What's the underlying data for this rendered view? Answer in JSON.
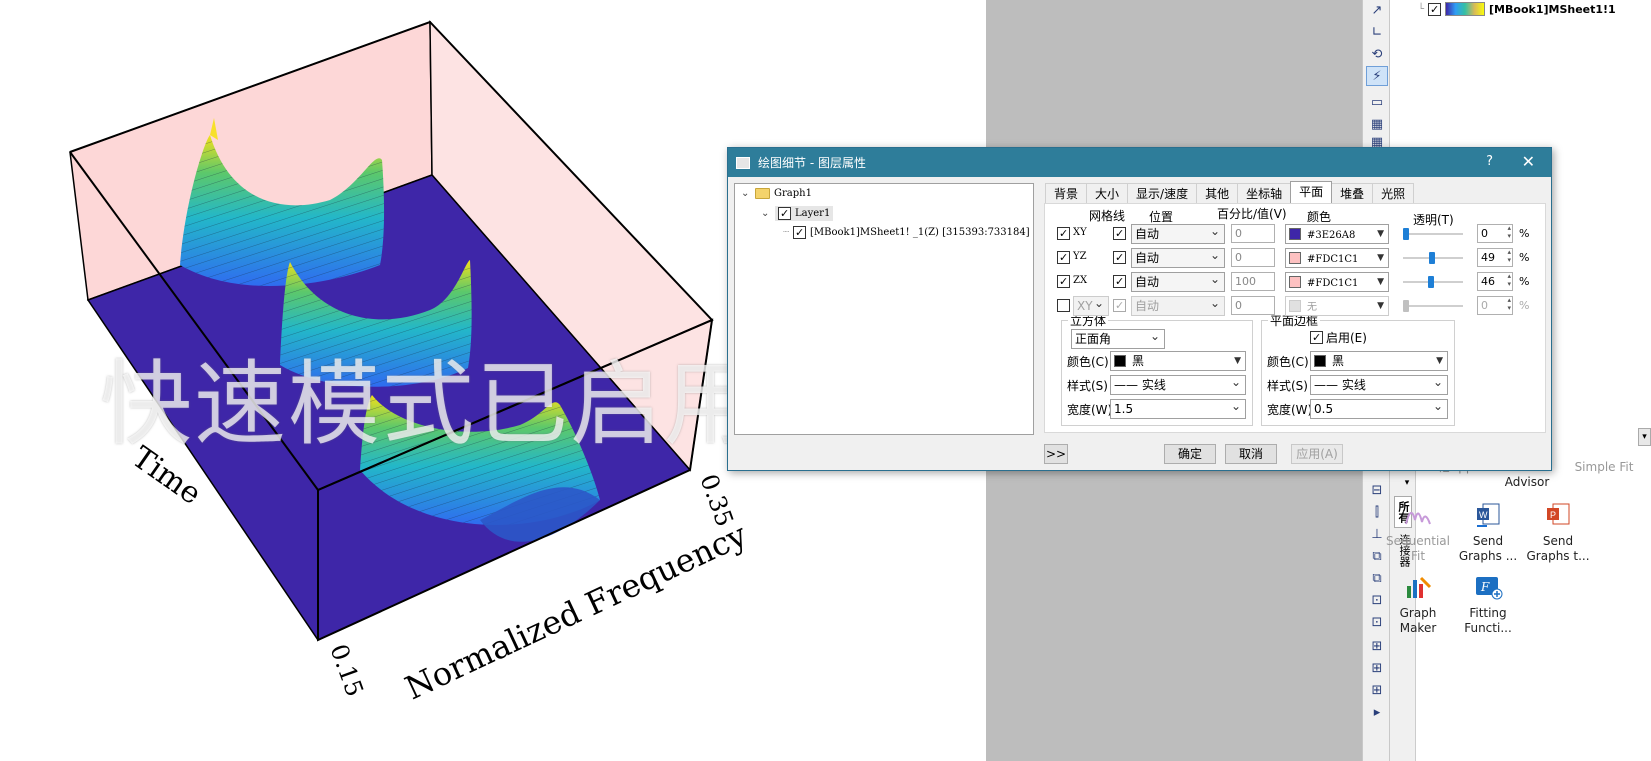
{
  "graph": {
    "x_axis_title": "Normalized Frequency",
    "y_axis_title": "Time",
    "x_tick_start": "0.15",
    "x_tick_end": "0.35",
    "watermark": "快速模式已启用",
    "wall_color": "#FDC1C1",
    "floor_color": "#3E26A8"
  },
  "right_panel": {
    "tree_item_label": "[MBook1]MSheet1!1",
    "apps": [
      {
        "label": "...他App",
        "faded": true
      },
      {
        "label": "Stats Advisor",
        "faded": false
      },
      {
        "label": "Simple Fit",
        "faded": true
      },
      {
        "label": "Sequential Fit",
        "faded": true
      },
      {
        "label": "Send Graphs ...",
        "faded": false
      },
      {
        "label": "Send Graphs t...",
        "faded": false
      },
      {
        "label": "Graph Maker",
        "faded": false
      },
      {
        "label": "Fitting Functi...",
        "faded": false
      }
    ],
    "vtab_all": "所有",
    "vtab_connectors": "连接器"
  },
  "dialog": {
    "title": "绘图细节 - 图层属性",
    "help": "?",
    "close": "✕",
    "tree": {
      "root": "Graph1",
      "layer": "Layer1",
      "plot": "[MBook1]MSheet1! _1(Z) [315393:733184]"
    },
    "tabs": [
      "背景",
      "大小",
      "显示/速度",
      "其他",
      "坐标轴",
      "平面",
      "堆叠",
      "光照"
    ],
    "active_tab": "平面",
    "headers": {
      "grid": "网格线",
      "position": "位置",
      "percent": "百分比/值(V)",
      "color": "颜色",
      "transparency": "透明(T)"
    },
    "planes": [
      {
        "name": "XY",
        "enabled": true,
        "grid": true,
        "position": "自动",
        "percent": "0",
        "color_hex": "#3E26A8",
        "color_label": "#3E26A8",
        "transparency": 0,
        "transparency_text": "0",
        "disabled": false
      },
      {
        "name": "YZ",
        "enabled": true,
        "grid": true,
        "position": "自动",
        "percent": "0",
        "color_hex": "#FDC1C1",
        "color_label": "#FDC1C1",
        "transparency": 49,
        "transparency_text": "49",
        "disabled": false
      },
      {
        "name": "ZX",
        "enabled": true,
        "grid": true,
        "position": "自动",
        "percent": "100",
        "color_hex": "#FDC1C1",
        "color_label": "#FDC1C1",
        "transparency": 46,
        "transparency_text": "46",
        "disabled": false
      },
      {
        "name": "XY",
        "enabled": false,
        "grid": true,
        "position": "自动",
        "percent": "0",
        "color_hex": "#E0E0E0",
        "color_label": "无",
        "transparency": 0,
        "transparency_text": "0",
        "disabled": true
      }
    ],
    "pct_sign": "%",
    "cube": {
      "title": "立方体",
      "mode": "正面角",
      "color_label": "颜色(C)",
      "color": "黑",
      "style_label": "样式(S)",
      "style": "—— 实线",
      "width_label": "宽度(W)",
      "width": "1.5"
    },
    "frame": {
      "title": "平面边框",
      "enable_label": "启用(E)",
      "color_label": "颜色(C)",
      "color": "黑",
      "style_label": "样式(S)",
      "style": "—— 实线",
      "width_label": "宽度(W)",
      "width": "0.5"
    },
    "buttons": {
      "expand": ">>",
      "ok": "确定",
      "cancel": "取消",
      "apply": "应用(A)"
    }
  }
}
